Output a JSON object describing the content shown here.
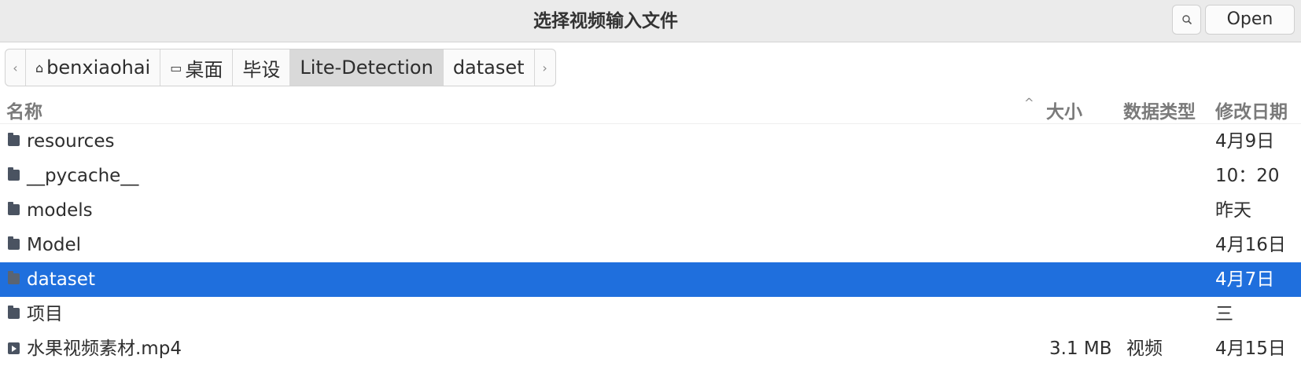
{
  "window": {
    "title": "选择视频输入文件",
    "open_label": "Open"
  },
  "pathbar": {
    "segments": [
      "benxiaohai",
      "桌面",
      "毕设",
      "Lite-Detection",
      "dataset"
    ],
    "active": "Lite-Detection"
  },
  "columns": {
    "name": "名称",
    "size": "大小",
    "type": "数据类型",
    "modified": "修改日期"
  },
  "files": [
    {
      "name": "resources",
      "size": "",
      "type": "",
      "modified": "4月9日",
      "kind": "folder",
      "selected": false
    },
    {
      "name": "__pycache__",
      "size": "",
      "type": "",
      "modified": "10：20",
      "kind": "folder",
      "selected": false
    },
    {
      "name": "models",
      "size": "",
      "type": "",
      "modified": "昨天",
      "kind": "folder",
      "selected": false
    },
    {
      "name": "Model",
      "size": "",
      "type": "",
      "modified": "4月16日",
      "kind": "folder",
      "selected": false
    },
    {
      "name": "dataset",
      "size": "",
      "type": "",
      "modified": "4月7日",
      "kind": "folder",
      "selected": true
    },
    {
      "name": "项目",
      "size": "",
      "type": "",
      "modified": "三",
      "kind": "folder",
      "selected": false
    },
    {
      "name": "水果视频素材.mp4",
      "size": "3.1 MB",
      "type": "视频",
      "modified": "4月15日",
      "kind": "video",
      "selected": false
    }
  ],
  "colors": {
    "selection": "#1f6fdd",
    "header_bg": "#ebebeb"
  },
  "icons": {
    "search": "search-icon",
    "home": "home-icon",
    "desktop": "desktop-icon",
    "folder": "folder-icon",
    "video": "video-file-icon",
    "sort": "sort-ascending-icon"
  }
}
